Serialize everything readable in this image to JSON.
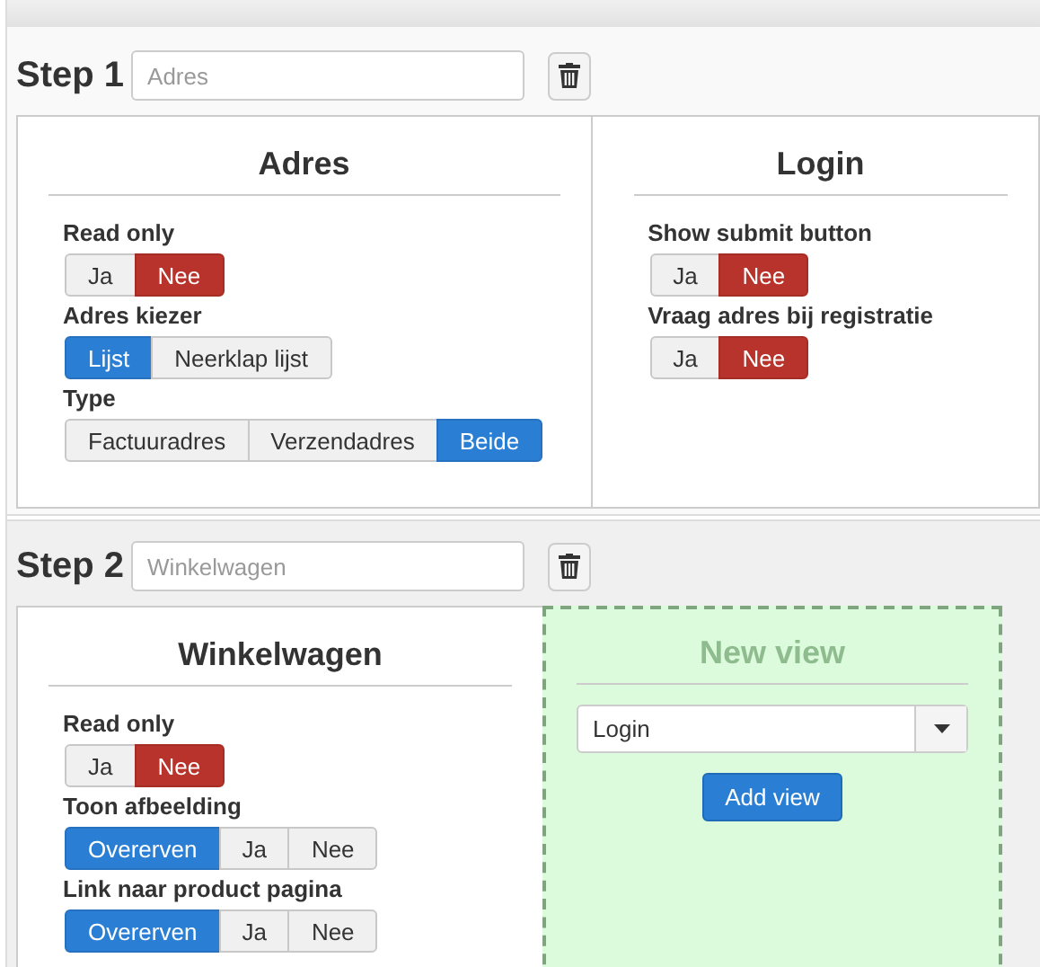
{
  "steps": [
    {
      "title": "Step 1",
      "name_field": {
        "placeholder": "Adres"
      },
      "views": [
        {
          "kind": "view",
          "title": "Adres",
          "settings": [
            {
              "label": "Read only",
              "kind": "yes-no",
              "options": [
                {
                  "label": "Ja",
                  "selected": false
                },
                {
                  "label": "Nee",
                  "selected": true
                }
              ]
            },
            {
              "label": "Adres kiezer",
              "kind": "choice",
              "options": [
                {
                  "label": "Lijst",
                  "selected": true
                },
                {
                  "label": "Neerklap lijst",
                  "selected": false
                }
              ]
            },
            {
              "label": "Type",
              "kind": "choice",
              "options": [
                {
                  "label": "Factuuradres",
                  "selected": false
                },
                {
                  "label": "Verzendadres",
                  "selected": false
                },
                {
                  "label": "Beide",
                  "selected": true
                }
              ]
            }
          ]
        },
        {
          "kind": "view",
          "title": "Login",
          "settings": [
            {
              "label": "Show submit button",
              "kind": "yes-no",
              "options": [
                {
                  "label": "Ja",
                  "selected": false
                },
                {
                  "label": "Nee",
                  "selected": true
                }
              ]
            },
            {
              "label": "Vraag adres bij registratie",
              "kind": "yes-no",
              "options": [
                {
                  "label": "Ja",
                  "selected": false
                },
                {
                  "label": "Nee",
                  "selected": true
                }
              ]
            }
          ]
        }
      ]
    },
    {
      "title": "Step 2",
      "name_field": {
        "placeholder": "Winkelwagen"
      },
      "views": [
        {
          "kind": "view",
          "title": "Winkelwagen",
          "settings": [
            {
              "label": "Read only",
              "kind": "yes-no",
              "options": [
                {
                  "label": "Ja",
                  "selected": false
                },
                {
                  "label": "Nee",
                  "selected": true
                }
              ]
            },
            {
              "label": "Toon afbeelding",
              "kind": "choice",
              "options": [
                {
                  "label": "Overerven",
                  "selected": true
                },
                {
                  "label": "Ja",
                  "selected": false
                },
                {
                  "label": "Nee",
                  "selected": false
                }
              ]
            },
            {
              "label": "Link naar product pagina",
              "kind": "choice",
              "options": [
                {
                  "label": "Overerven",
                  "selected": true
                },
                {
                  "label": "Ja",
                  "selected": false
                },
                {
                  "label": "Nee",
                  "selected": false
                }
              ]
            }
          ]
        },
        {
          "kind": "new",
          "title": "New view",
          "select": {
            "value": "Login"
          },
          "button": "Add view"
        }
      ]
    }
  ]
}
